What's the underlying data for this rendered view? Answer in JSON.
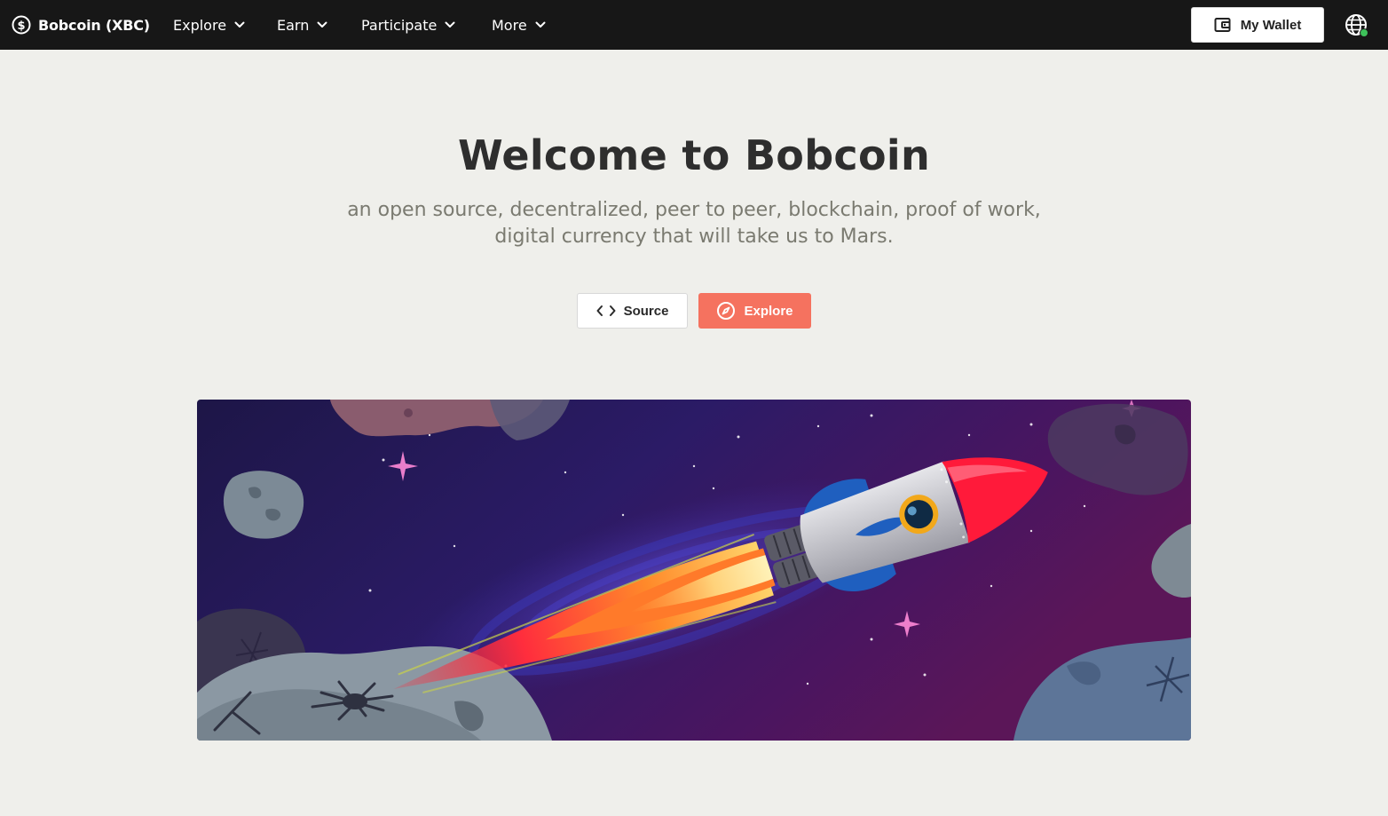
{
  "nav": {
    "brand": "Bobcoin (XBC)",
    "brand_icon": "dollar-circle-icon",
    "items": [
      {
        "label": "Explore",
        "icon": "chevron-down-icon"
      },
      {
        "label": "Earn",
        "icon": "chevron-down-icon"
      },
      {
        "label": "Participate",
        "icon": "chevron-down-icon"
      },
      {
        "label": "More",
        "icon": "chevron-down-icon"
      }
    ],
    "wallet_label": "My Wallet",
    "wallet_icon": "wallet-icon",
    "language_icon": "globe-icon",
    "status_color": "#3ec15a"
  },
  "hero": {
    "title": "Welcome to Bobcoin",
    "subtitle_line1": "an open source, decentralized, peer to peer, blockchain, proof of work,",
    "subtitle_line2": "digital currency that will take us to Mars.",
    "source_label": "Source",
    "source_icon": "code-icon",
    "explore_label": "Explore",
    "explore_icon": "compass-icon",
    "accent_color": "#f5725f"
  },
  "banner": {
    "illustration": "rocket-in-space-illustration"
  }
}
